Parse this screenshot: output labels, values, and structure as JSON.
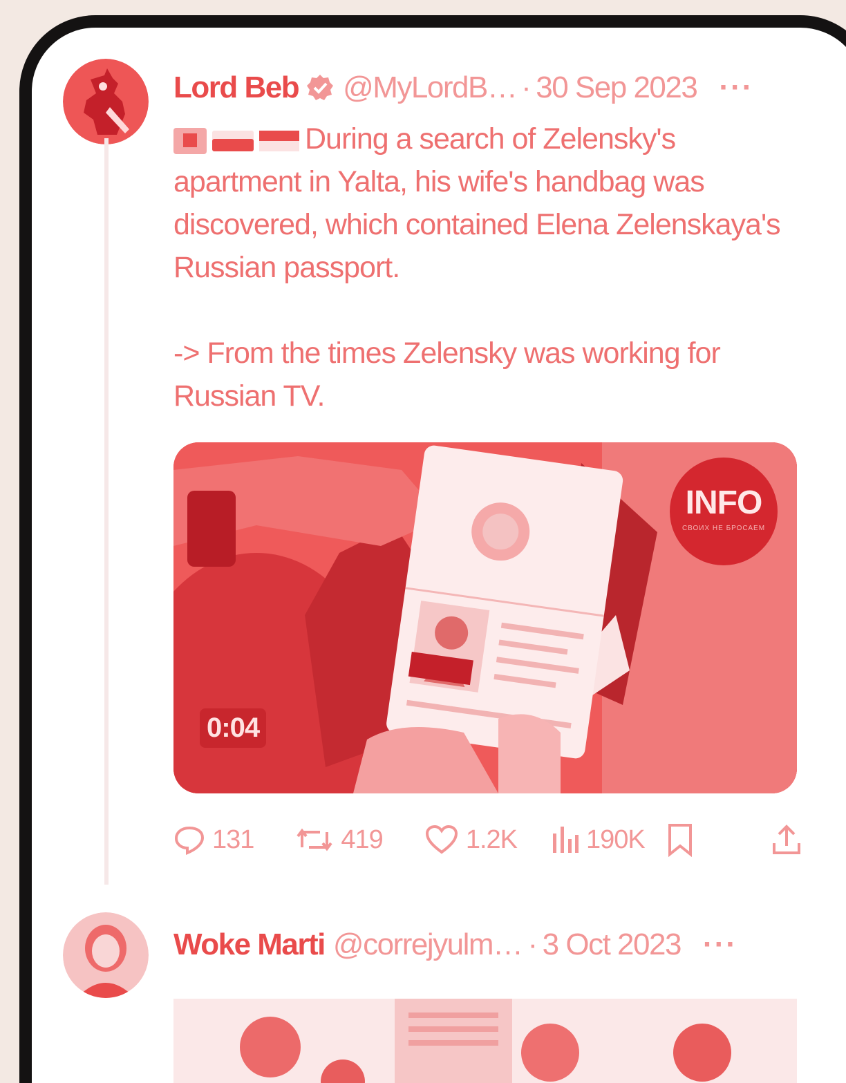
{
  "tweets": [
    {
      "name": "Lord Beb",
      "handle": "@MyLordB…",
      "separator": "·",
      "date": "30 Sep 2023",
      "more": "···",
      "verified_icon": "verified-badge-icon",
      "flags": [
        "flag-icon",
        "flag-icon",
        "flag-icon"
      ],
      "text_lines": [
        "During a search of Zelensky's apartment in Yalta, his wife's handbag was discovered, which contained Elena Zelenskaya's Russian passport.",
        "-> From the times Zelensky was working for Russian TV."
      ],
      "media": {
        "duration": "0:04",
        "badge": "INFO",
        "badge_sub": "СВОИХ НЕ БРОСАЕМ"
      },
      "stats": {
        "replies": "131",
        "reposts": "419",
        "likes": "1.2K",
        "views": "190K"
      }
    },
    {
      "name": "Woke Marti",
      "handle": "@correjyulm…",
      "separator": "·",
      "date": "3 Oct 2023",
      "more": "···"
    }
  ],
  "colors": {
    "accent": "#e94b4b",
    "muted": "#f29696",
    "frame": "#141212",
    "background": "#f3e9e3"
  }
}
